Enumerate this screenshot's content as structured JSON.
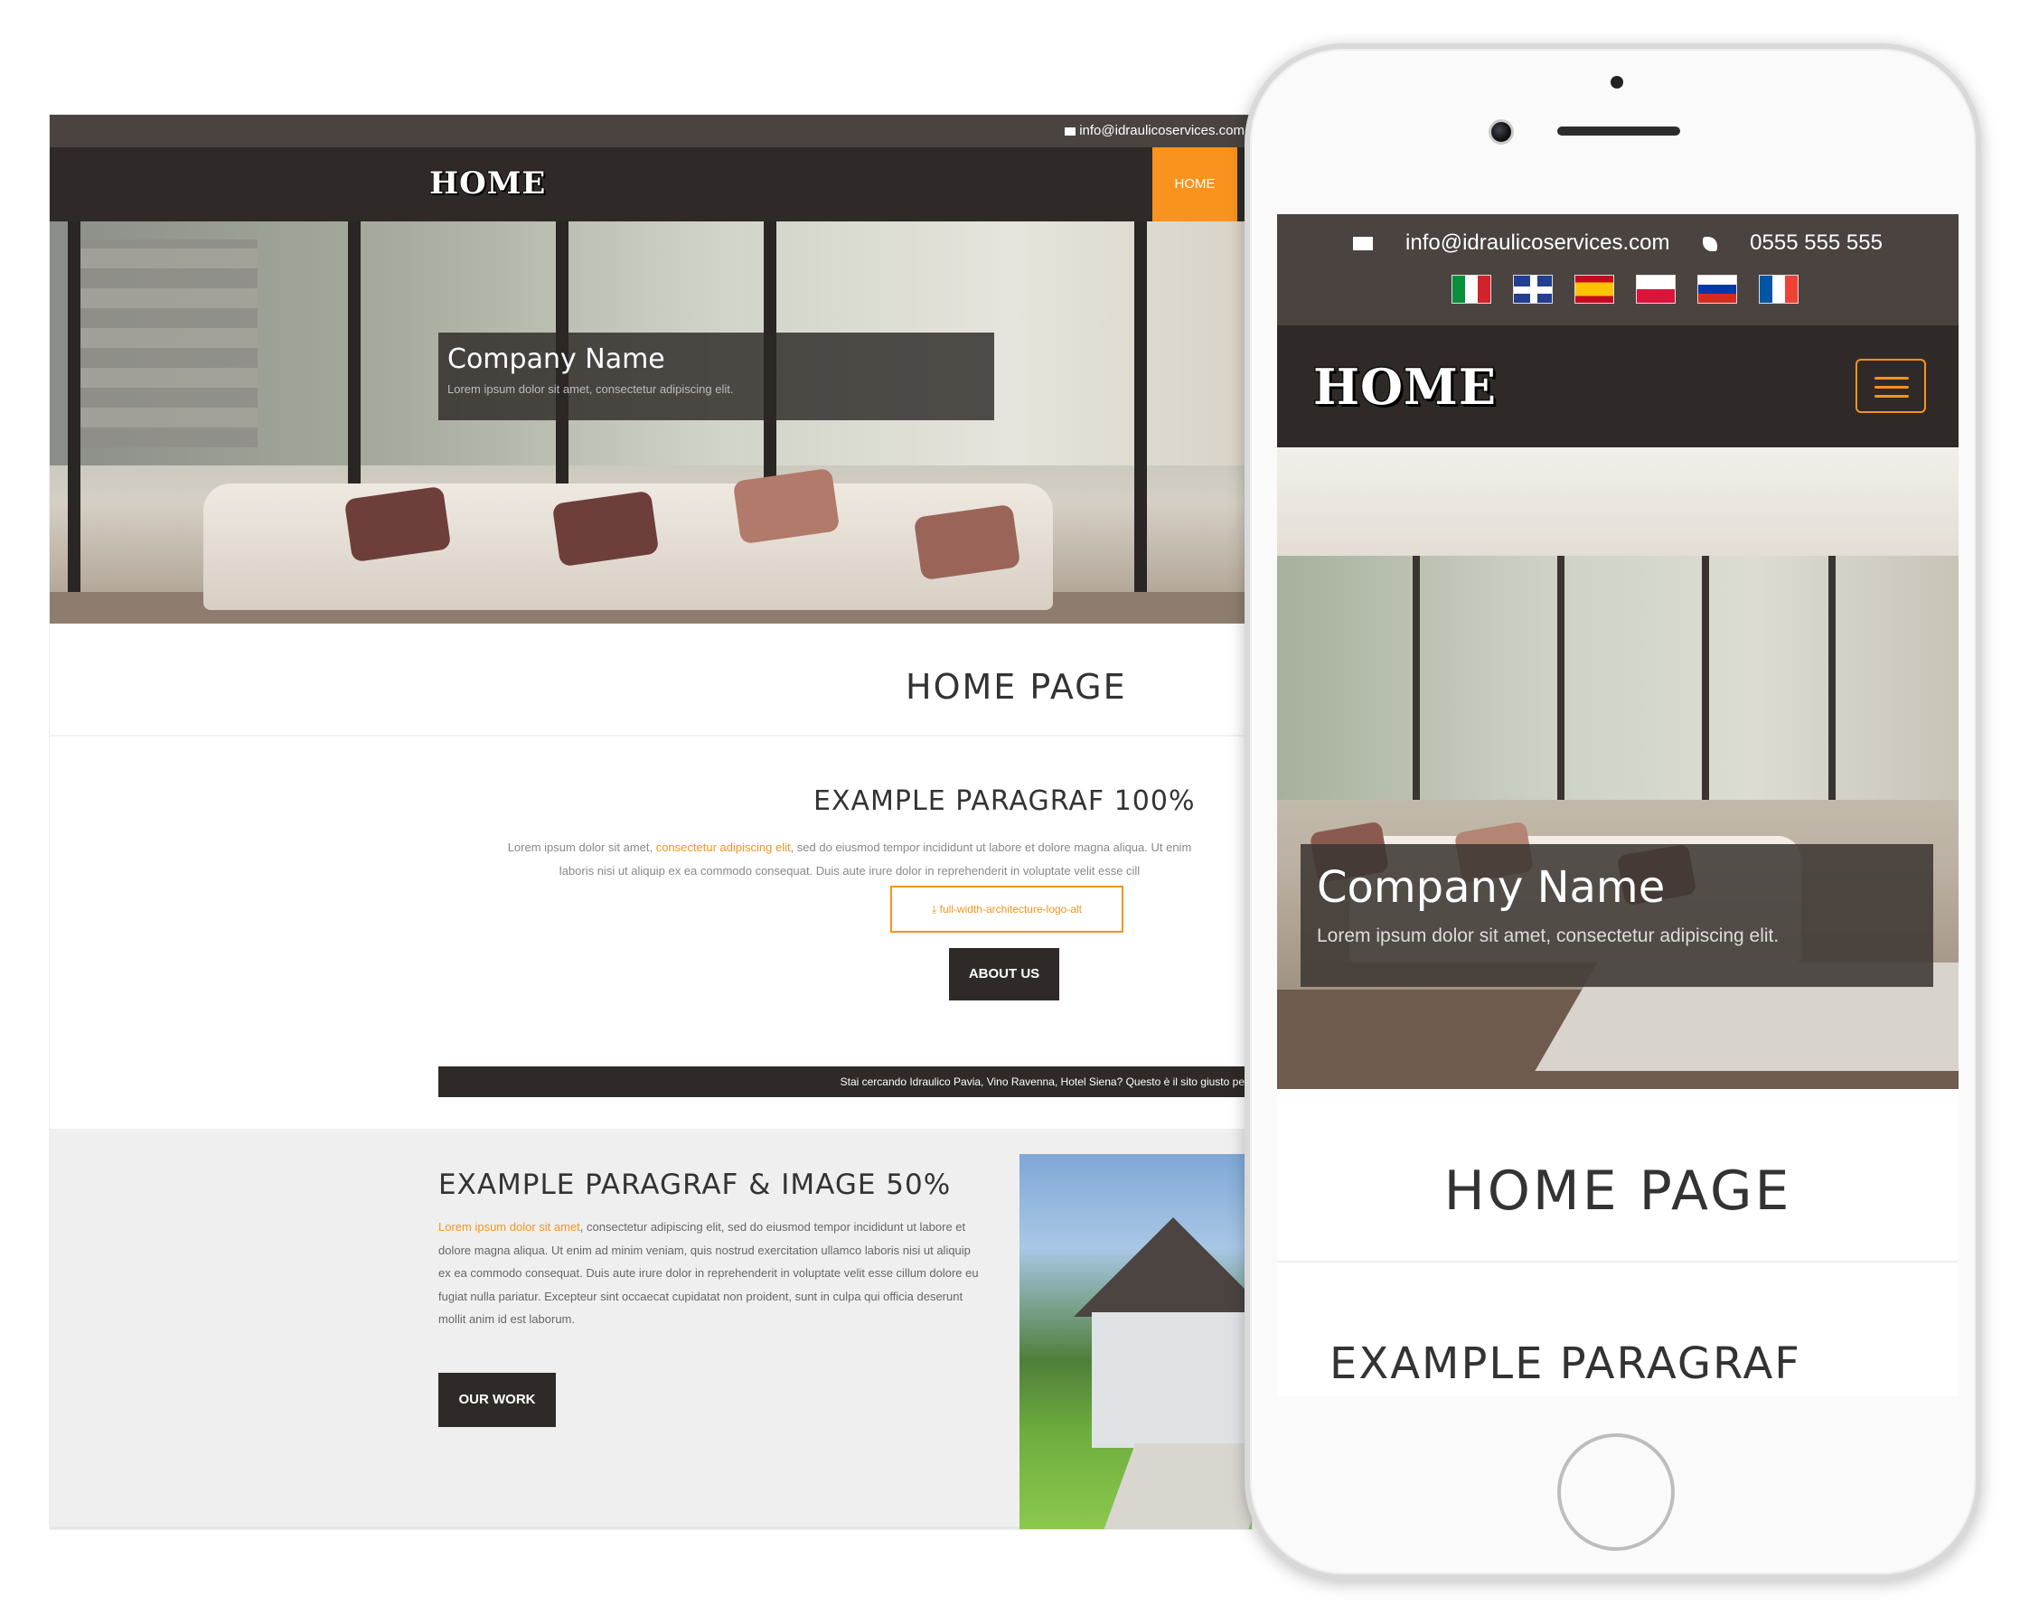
{
  "desktop": {
    "topbar": {
      "email": "info@idraulicoservices.com"
    },
    "nav": {
      "logo": "HOME",
      "home_label": "HOME"
    },
    "hero": {
      "title": "Company Name",
      "subtitle": "Lorem ipsum dolor sit amet, consectetur adipiscing elit."
    },
    "page_title": "HOME PAGE",
    "section1": {
      "heading": "EXAMPLE PARAGRAF 100%",
      "text_a": "Lorem ipsum dolor sit amet, ",
      "text_link": "consectetur adipiscing elit",
      "text_b": ", sed do eiusmod tempor incididunt ut labore et dolore magna aliqua. Ut enim",
      "text_line2": "laboris nisi ut aliquip ex ea commodo consequat. Duis aute irure dolor in reprehenderit in voluptate velit esse cill",
      "download_label": "full-width-architecture-logo-alt",
      "about_label": "ABOUT US",
      "ticker": "Stai cercando Idraulico Pavia, Vino Ravenna, Hotel Siena? Questo è il sito giusto per"
    },
    "section2": {
      "heading": "EXAMPLE PARAGRAF & IMAGE 50%",
      "text_link": "Lorem ipsum dolor sit amet",
      "text_rest": ", consectetur adipiscing elit, sed do eiusmod tempor incididunt ut labore et dolore magna aliqua. Ut enim ad minim veniam, quis nostrud exercitation ullamco laboris nisi ut aliquip ex ea commodo consequat. Duis aute irure dolor in reprehenderit in voluptate velit esse cillum dolore eu fugiat nulla pariatur. Excepteur sint occaecat cupidatat non proident, sunt in culpa qui officia deserunt mollit anim id est laborum.",
      "work_label": "OUR WORK"
    }
  },
  "mobile": {
    "topbar": {
      "email": "info@idraulicoservices.com",
      "phone": "0555 555 555"
    },
    "flags": [
      "italian-flag-icon",
      "uk-flag-icon",
      "spanish-flag-icon",
      "polish-flag-icon",
      "russian-flag-icon",
      "french-flag-icon"
    ],
    "nav": {
      "logo": "HOME"
    },
    "hero": {
      "title": "Company Name",
      "subtitle": "Lorem ipsum dolor sit amet, consectetur adipiscing elit."
    },
    "page_title": "HOME PAGE",
    "section_heading": "EXAMPLE PARAGRAF"
  },
  "colors": {
    "accent": "#f7931e",
    "dark": "#2f2a28",
    "topbar": "#4a4340"
  }
}
